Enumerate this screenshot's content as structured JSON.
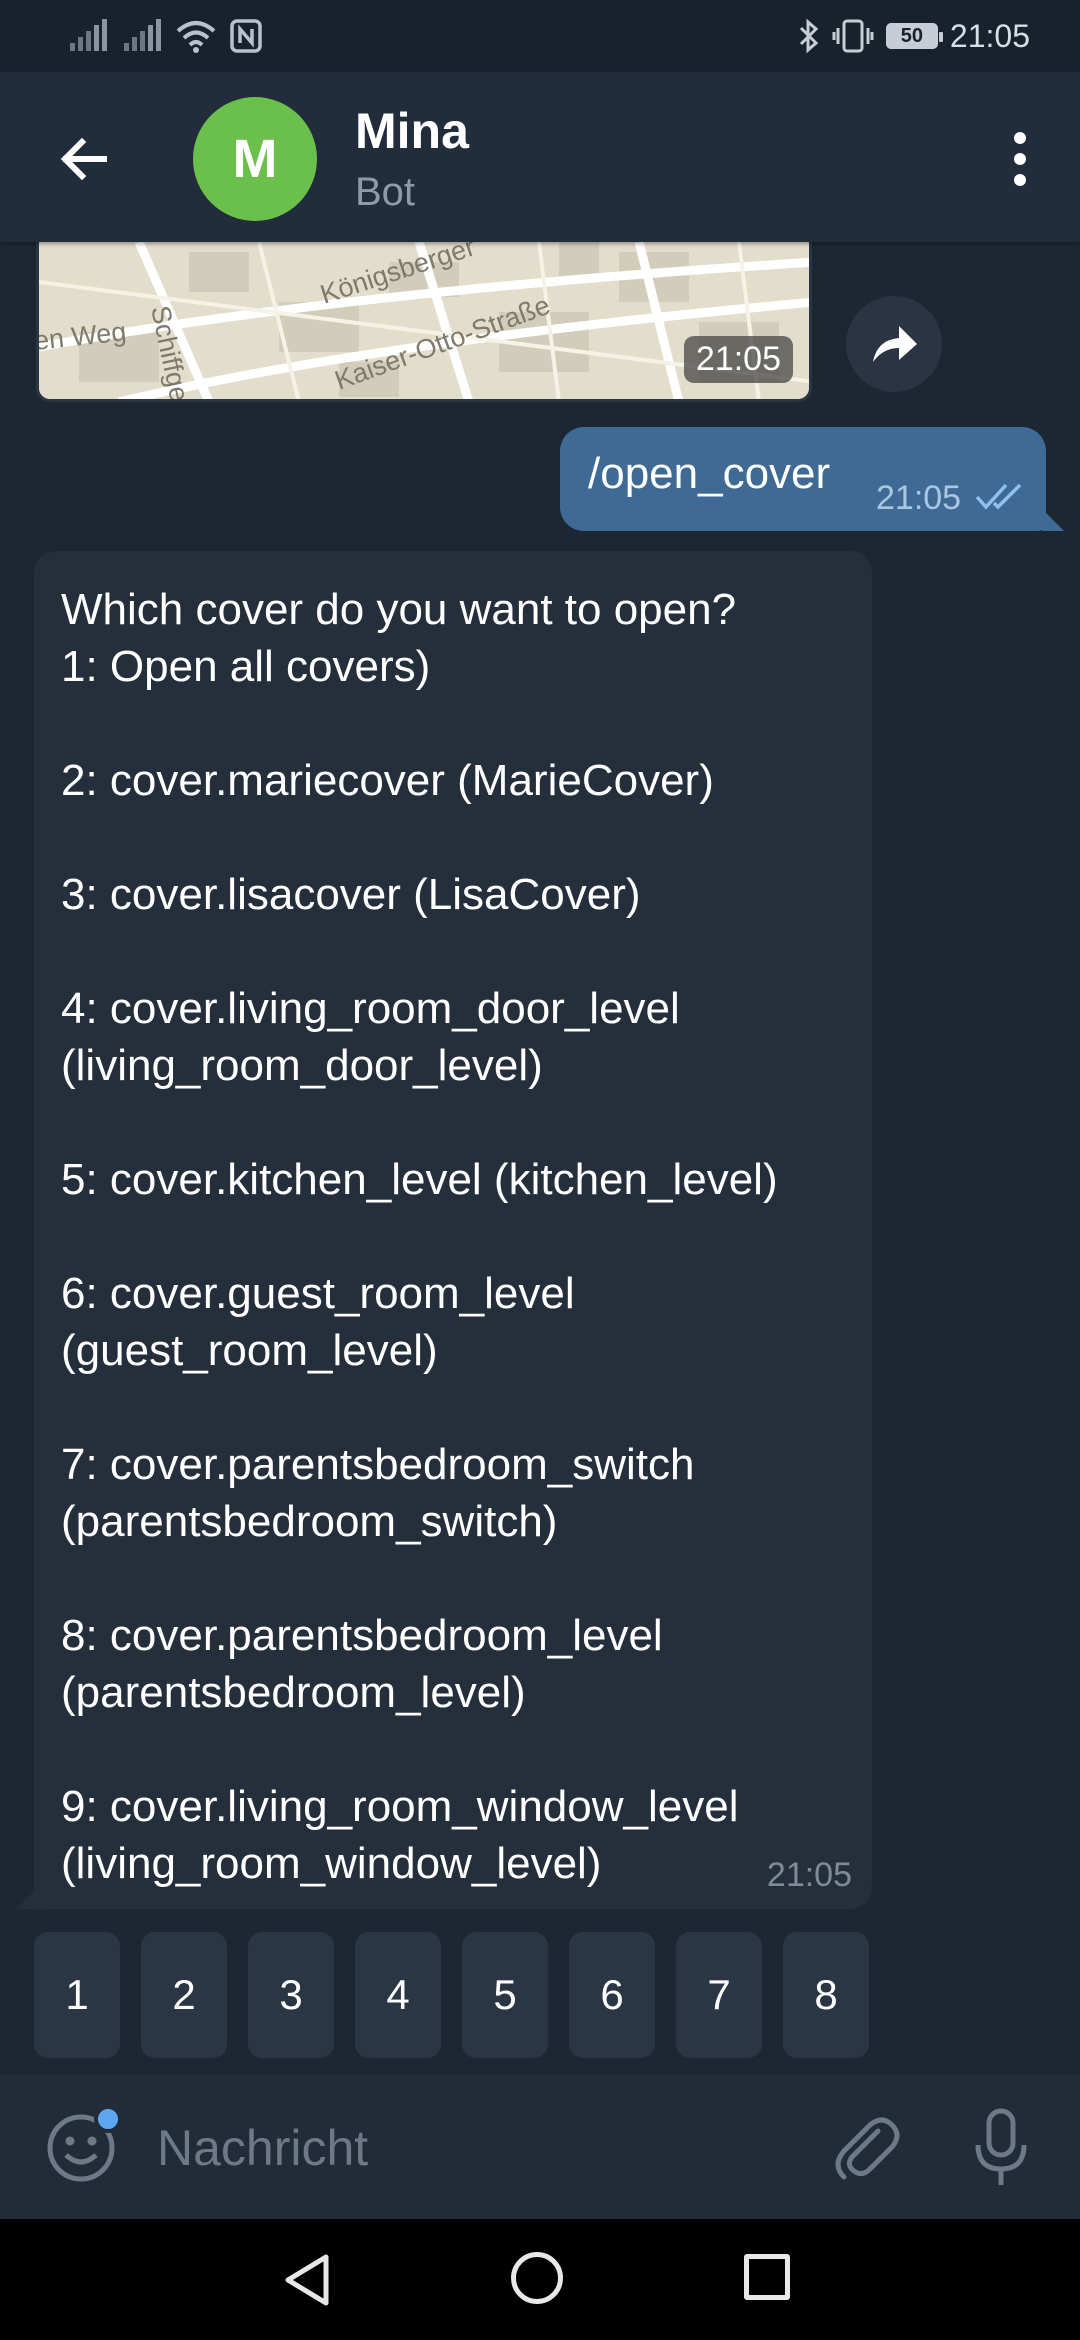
{
  "status_bar": {
    "time": "21:05",
    "battery": "50",
    "icons": [
      "signal-icon",
      "signal-icon",
      "wifi-icon",
      "nfc-icon",
      "bluetooth-icon",
      "vibrate-icon",
      "battery-icon"
    ]
  },
  "header": {
    "avatar_letter": "M",
    "name": "Mina",
    "subtitle": "Bot"
  },
  "map": {
    "time": "21:05",
    "streets": [
      "Königsberger",
      "Kaiser-Otto-Straße",
      "Schiffge",
      "en Weg"
    ]
  },
  "outgoing": {
    "text": "/open_cover",
    "time": "21:05"
  },
  "incoming": {
    "lines": [
      "Which cover do you want to open?",
      "1: Open all covers)",
      "",
      "2: cover.mariecover (MarieCover)",
      "",
      "3: cover.lisacover (LisaCover)",
      "",
      "4: cover.living_room_door_level",
      "(living_room_door_level)",
      "",
      "5: cover.kitchen_level (kitchen_level)",
      "",
      "6: cover.guest_room_level",
      "(guest_room_level)",
      "",
      "7: cover.parentsbedroom_switch",
      "(parentsbedroom_switch)",
      "",
      "8: cover.parentsbedroom_level",
      "(parentsbedroom_level)",
      "",
      "9: cover.living_room_window_level",
      "(living_room_window_level)"
    ],
    "time": "21:05"
  },
  "keyboard": {
    "buttons": [
      "1",
      "2",
      "3",
      "4",
      "5",
      "6",
      "7",
      "8"
    ]
  },
  "input": {
    "placeholder": "Nachricht"
  },
  "colors": {
    "accent": "#3f6a95",
    "avatar": "#6bc04b",
    "background": "#1d2733"
  }
}
